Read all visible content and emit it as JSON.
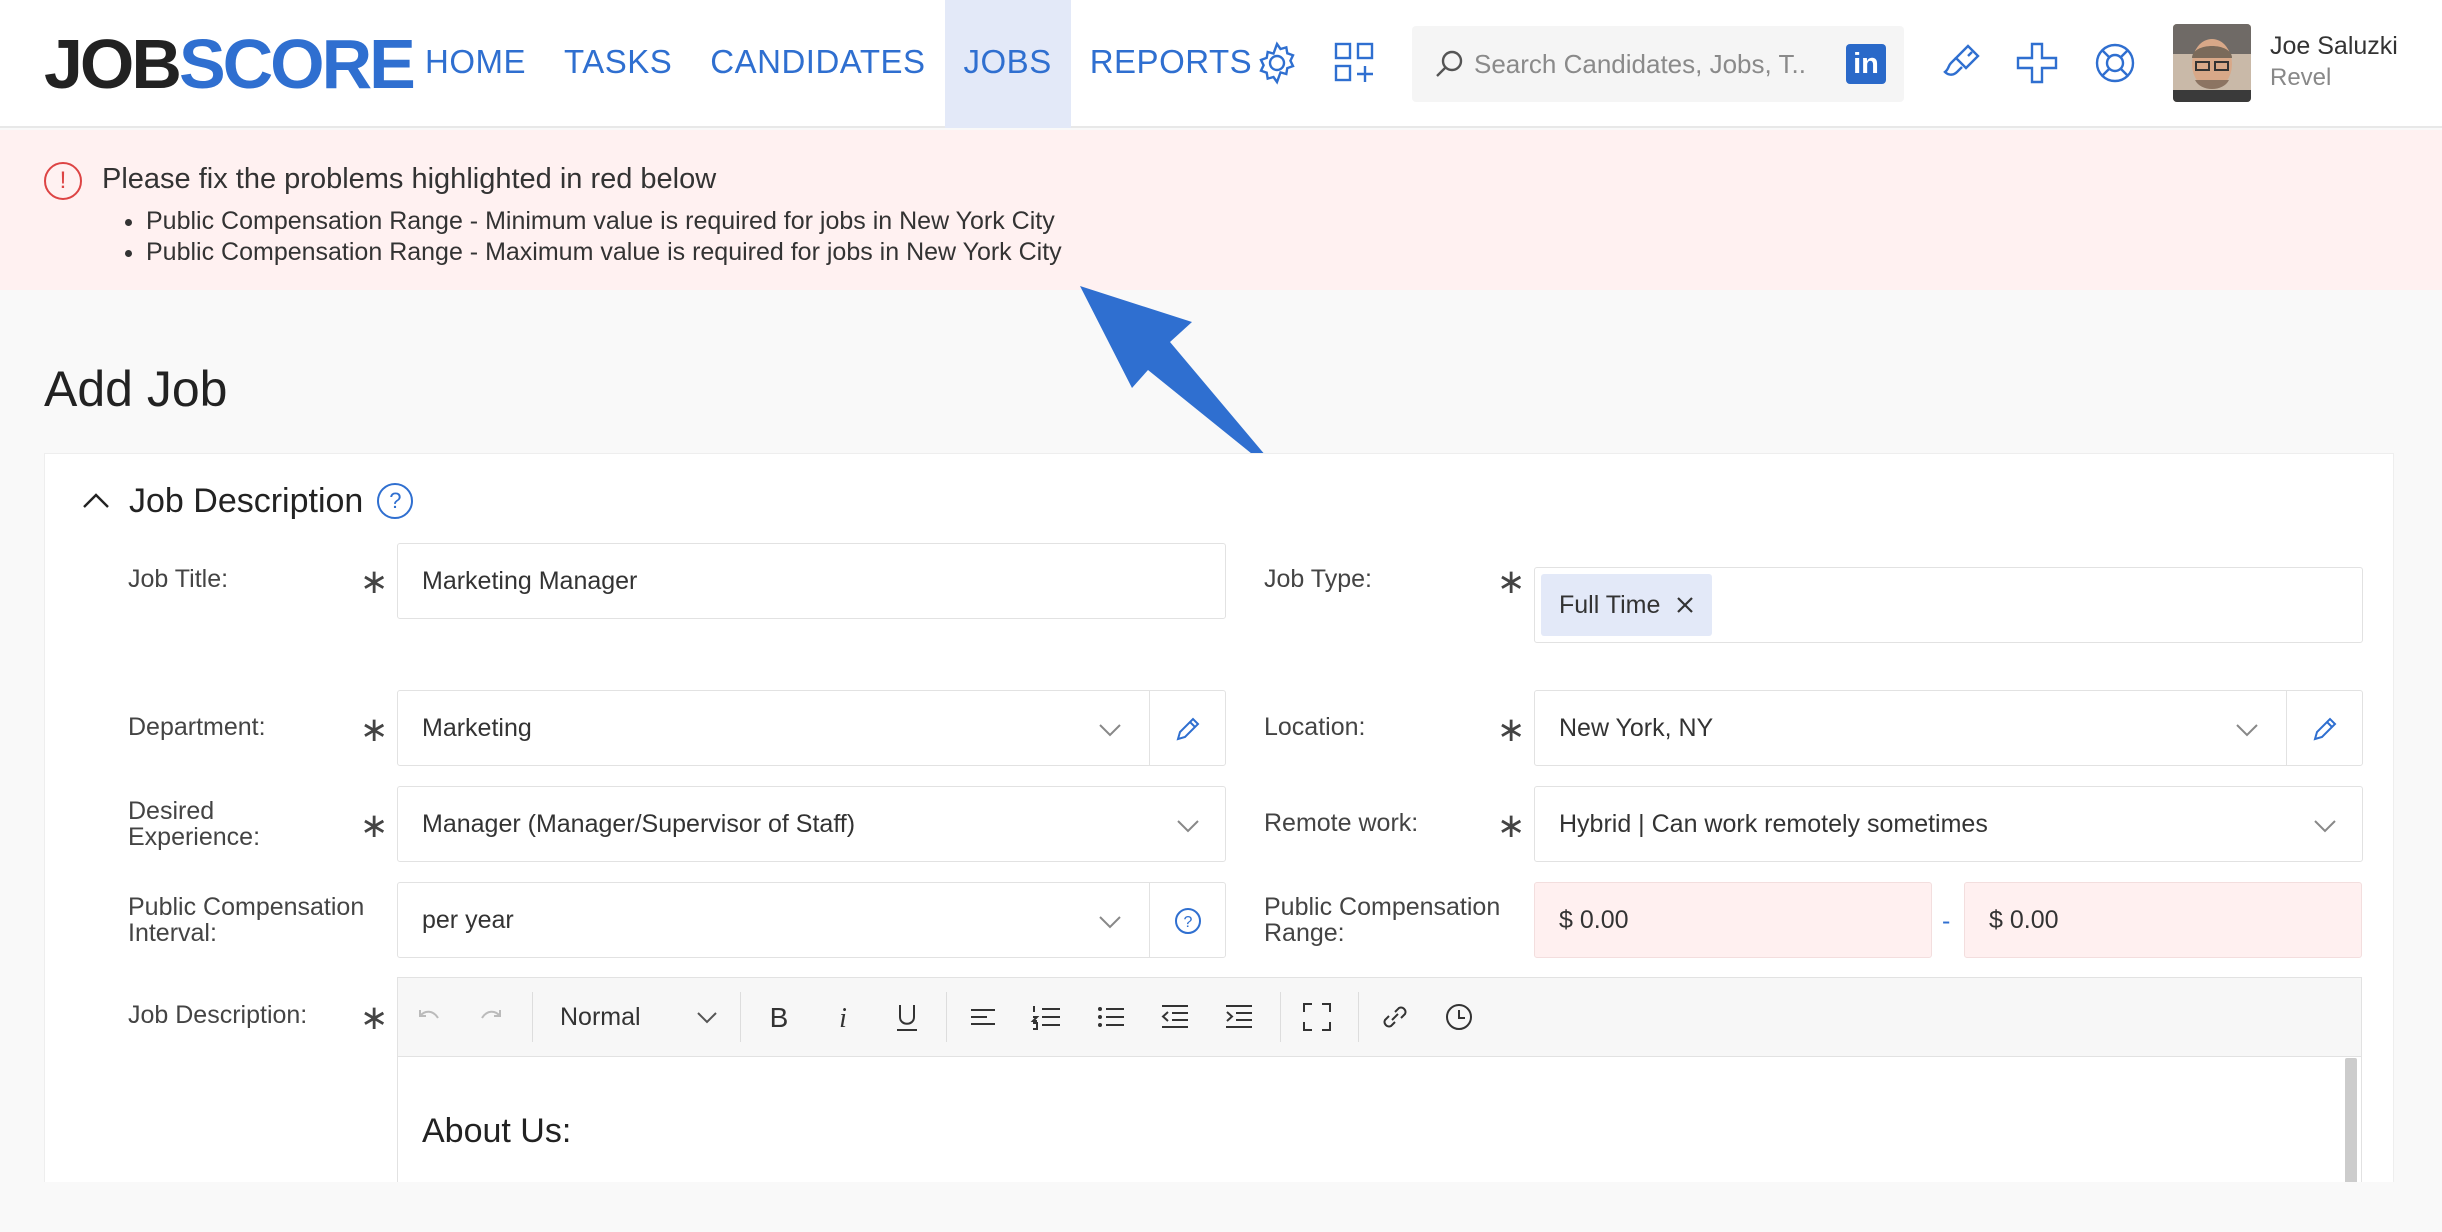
{
  "header": {
    "logo_part1": "JOB",
    "logo_part2": "SCORE",
    "nav": [
      "HOME",
      "TASKS",
      "CANDIDATES",
      "JOBS",
      "REPORTS"
    ],
    "active_nav": "JOBS",
    "search_placeholder": "Search Candidates, Jobs, T...",
    "linkedin_label": "in",
    "user_name": "Joe Saluzki",
    "user_org": "Revel",
    "icons": [
      "gear-icon",
      "apps-add-icon",
      "search-icon",
      "linkedin-icon",
      "paintbrush-icon",
      "plus-icon",
      "lifebuoy-icon"
    ]
  },
  "banner": {
    "icon": "!",
    "title": "Please fix the problems highlighted in red below",
    "items": [
      "Public Compensation Range - Minimum value is required for jobs in New York City",
      "Public Compensation Range - Maximum value is required for jobs in New York City"
    ]
  },
  "page": {
    "title": "Add Job"
  },
  "section": {
    "title": "Job Description",
    "help": "?"
  },
  "form": {
    "required_mark": "∗",
    "job_title_label": "Job Title:",
    "job_title_value": "Marketing Manager",
    "job_type_label": "Job Type:",
    "job_type_tag": "Full Time",
    "department_label": "Department:",
    "department_value": "Marketing",
    "location_label": "Location:",
    "location_value": "New York, NY",
    "experience_label_1": "Desired",
    "experience_label_2": "Experience:",
    "experience_value": "Manager (Manager/Supervisor of Staff)",
    "remote_label": "Remote work:",
    "remote_value": "Hybrid | Can work remotely sometimes",
    "interval_label_1": "Public Compensation",
    "interval_label_2": "Interval:",
    "interval_value": "per year",
    "range_label_1": "Public Compensation",
    "range_label_2": "Range:",
    "range_min": "$  0.00",
    "range_sep": "-",
    "range_max": "$  0.00",
    "description_label": "Job Description:"
  },
  "editor": {
    "format": "Normal",
    "content_heading": "About Us:"
  },
  "colors": {
    "brand": "#2f6fd0",
    "error_bg": "#fff1f1",
    "active_nav_bg": "#e3e9f8"
  }
}
